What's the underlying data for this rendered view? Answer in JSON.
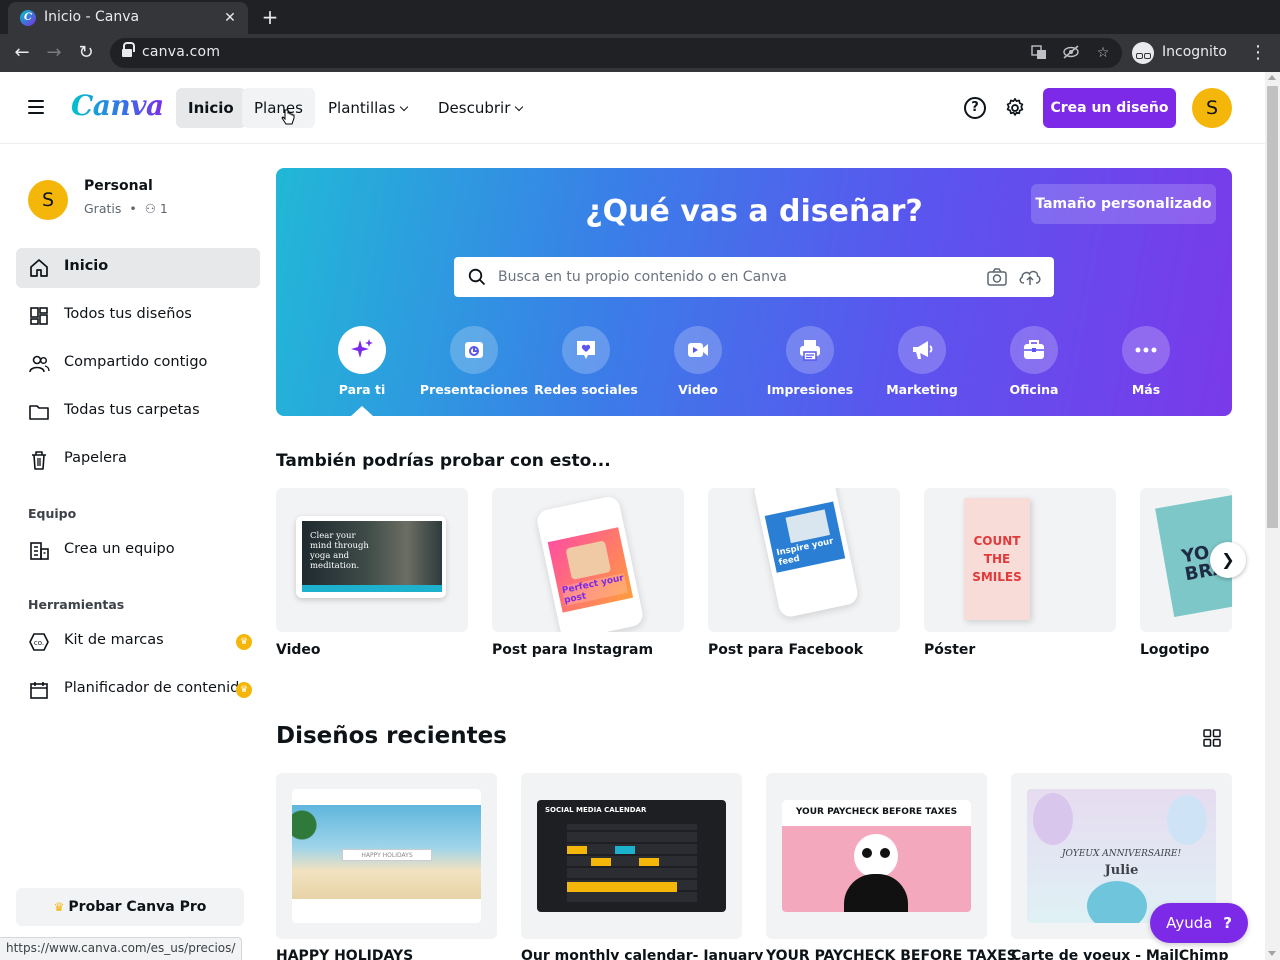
{
  "browser": {
    "tab_title": "Inicio - Canva",
    "url": "canva.com",
    "profile_label": "Incognito",
    "status_url": "https://www.canva.com/es_us/precios/"
  },
  "header": {
    "logo": "Canva",
    "nav": [
      {
        "label": "Inicio",
        "active": true
      },
      {
        "label": "Planes"
      },
      {
        "label": "Plantillas",
        "has_dropdown": true
      },
      {
        "label": "Descubrir",
        "has_dropdown": true
      }
    ],
    "create_label": "Crea un diseño",
    "avatar_letter": "S"
  },
  "sidebar": {
    "account_name": "Personal",
    "account_plan": "Gratis",
    "member_count": "1",
    "avatar_letter": "S",
    "items": [
      {
        "label": "Inicio",
        "icon": "home-icon",
        "active": true
      },
      {
        "label": "Todos tus diseños",
        "icon": "grid-icon"
      },
      {
        "label": "Compartido contigo",
        "icon": "people-icon"
      },
      {
        "label": "Todas tus carpetas",
        "icon": "folder-icon"
      },
      {
        "label": "Papelera",
        "icon": "trash-icon"
      }
    ],
    "team_section": "Equipo",
    "team_items": [
      {
        "label": "Crea un equipo",
        "icon": "building-icon"
      }
    ],
    "tools_section": "Herramientas",
    "tools_items": [
      {
        "label": "Kit de marcas",
        "icon": "brand-kit-icon",
        "pro": true
      },
      {
        "label": "Planificador de contenido",
        "icon": "calendar-icon",
        "pro": true
      }
    ],
    "pro_cta": "Probar Canva Pro"
  },
  "hero": {
    "title": "¿Qué vas a diseñar?",
    "custom_size": "Tamaño personalizado",
    "search_placeholder": "Busca en tu propio contenido o en Canva",
    "categories": [
      {
        "label": "Para ti",
        "icon": "sparkle-icon",
        "active": true
      },
      {
        "label": "Presentaciones",
        "icon": "presentation-icon"
      },
      {
        "label": "Redes sociales",
        "icon": "heart-icon"
      },
      {
        "label": "Video",
        "icon": "video-icon"
      },
      {
        "label": "Impresiones",
        "icon": "printer-icon"
      },
      {
        "label": "Marketing",
        "icon": "megaphone-icon"
      },
      {
        "label": "Oficina",
        "icon": "briefcase-icon"
      },
      {
        "label": "Más",
        "icon": "more-icon"
      }
    ]
  },
  "suggestions": {
    "title": "También podrías probar con esto...",
    "items": [
      {
        "label": "Video",
        "thumb_text": "Clear your mind through yoga and meditation."
      },
      {
        "label": "Post para Instagram",
        "thumb_text": "Perfect your post"
      },
      {
        "label": "Post para Facebook",
        "thumb_text": "Inspire your feed"
      },
      {
        "label": "Póster",
        "thumb_text": "COUNT THE SMILES"
      },
      {
        "label": "Logotipo",
        "thumb_text": "YO BRAN"
      }
    ]
  },
  "recent": {
    "title": "Diseños recientes",
    "items": [
      {
        "title": "HAPPY HOLIDAYS",
        "thumb_text": "HAPPY HOLIDAYS"
      },
      {
        "title": "Our monthly calendar- January",
        "thumb_text": "SOCIAL MEDIA CALENDAR"
      },
      {
        "title": "YOUR PAYCHECK BEFORE TAXES",
        "thumb_text": "YOUR PAYCHECK BEFORE TAXES"
      },
      {
        "title": "Carte de voeux - MailChimp",
        "thumb_text": "JOYEUX ANNIVERSAIRE!",
        "thumb_name": "Julie"
      }
    ]
  },
  "help_label": "Ayuda",
  "help_symbol": "?"
}
